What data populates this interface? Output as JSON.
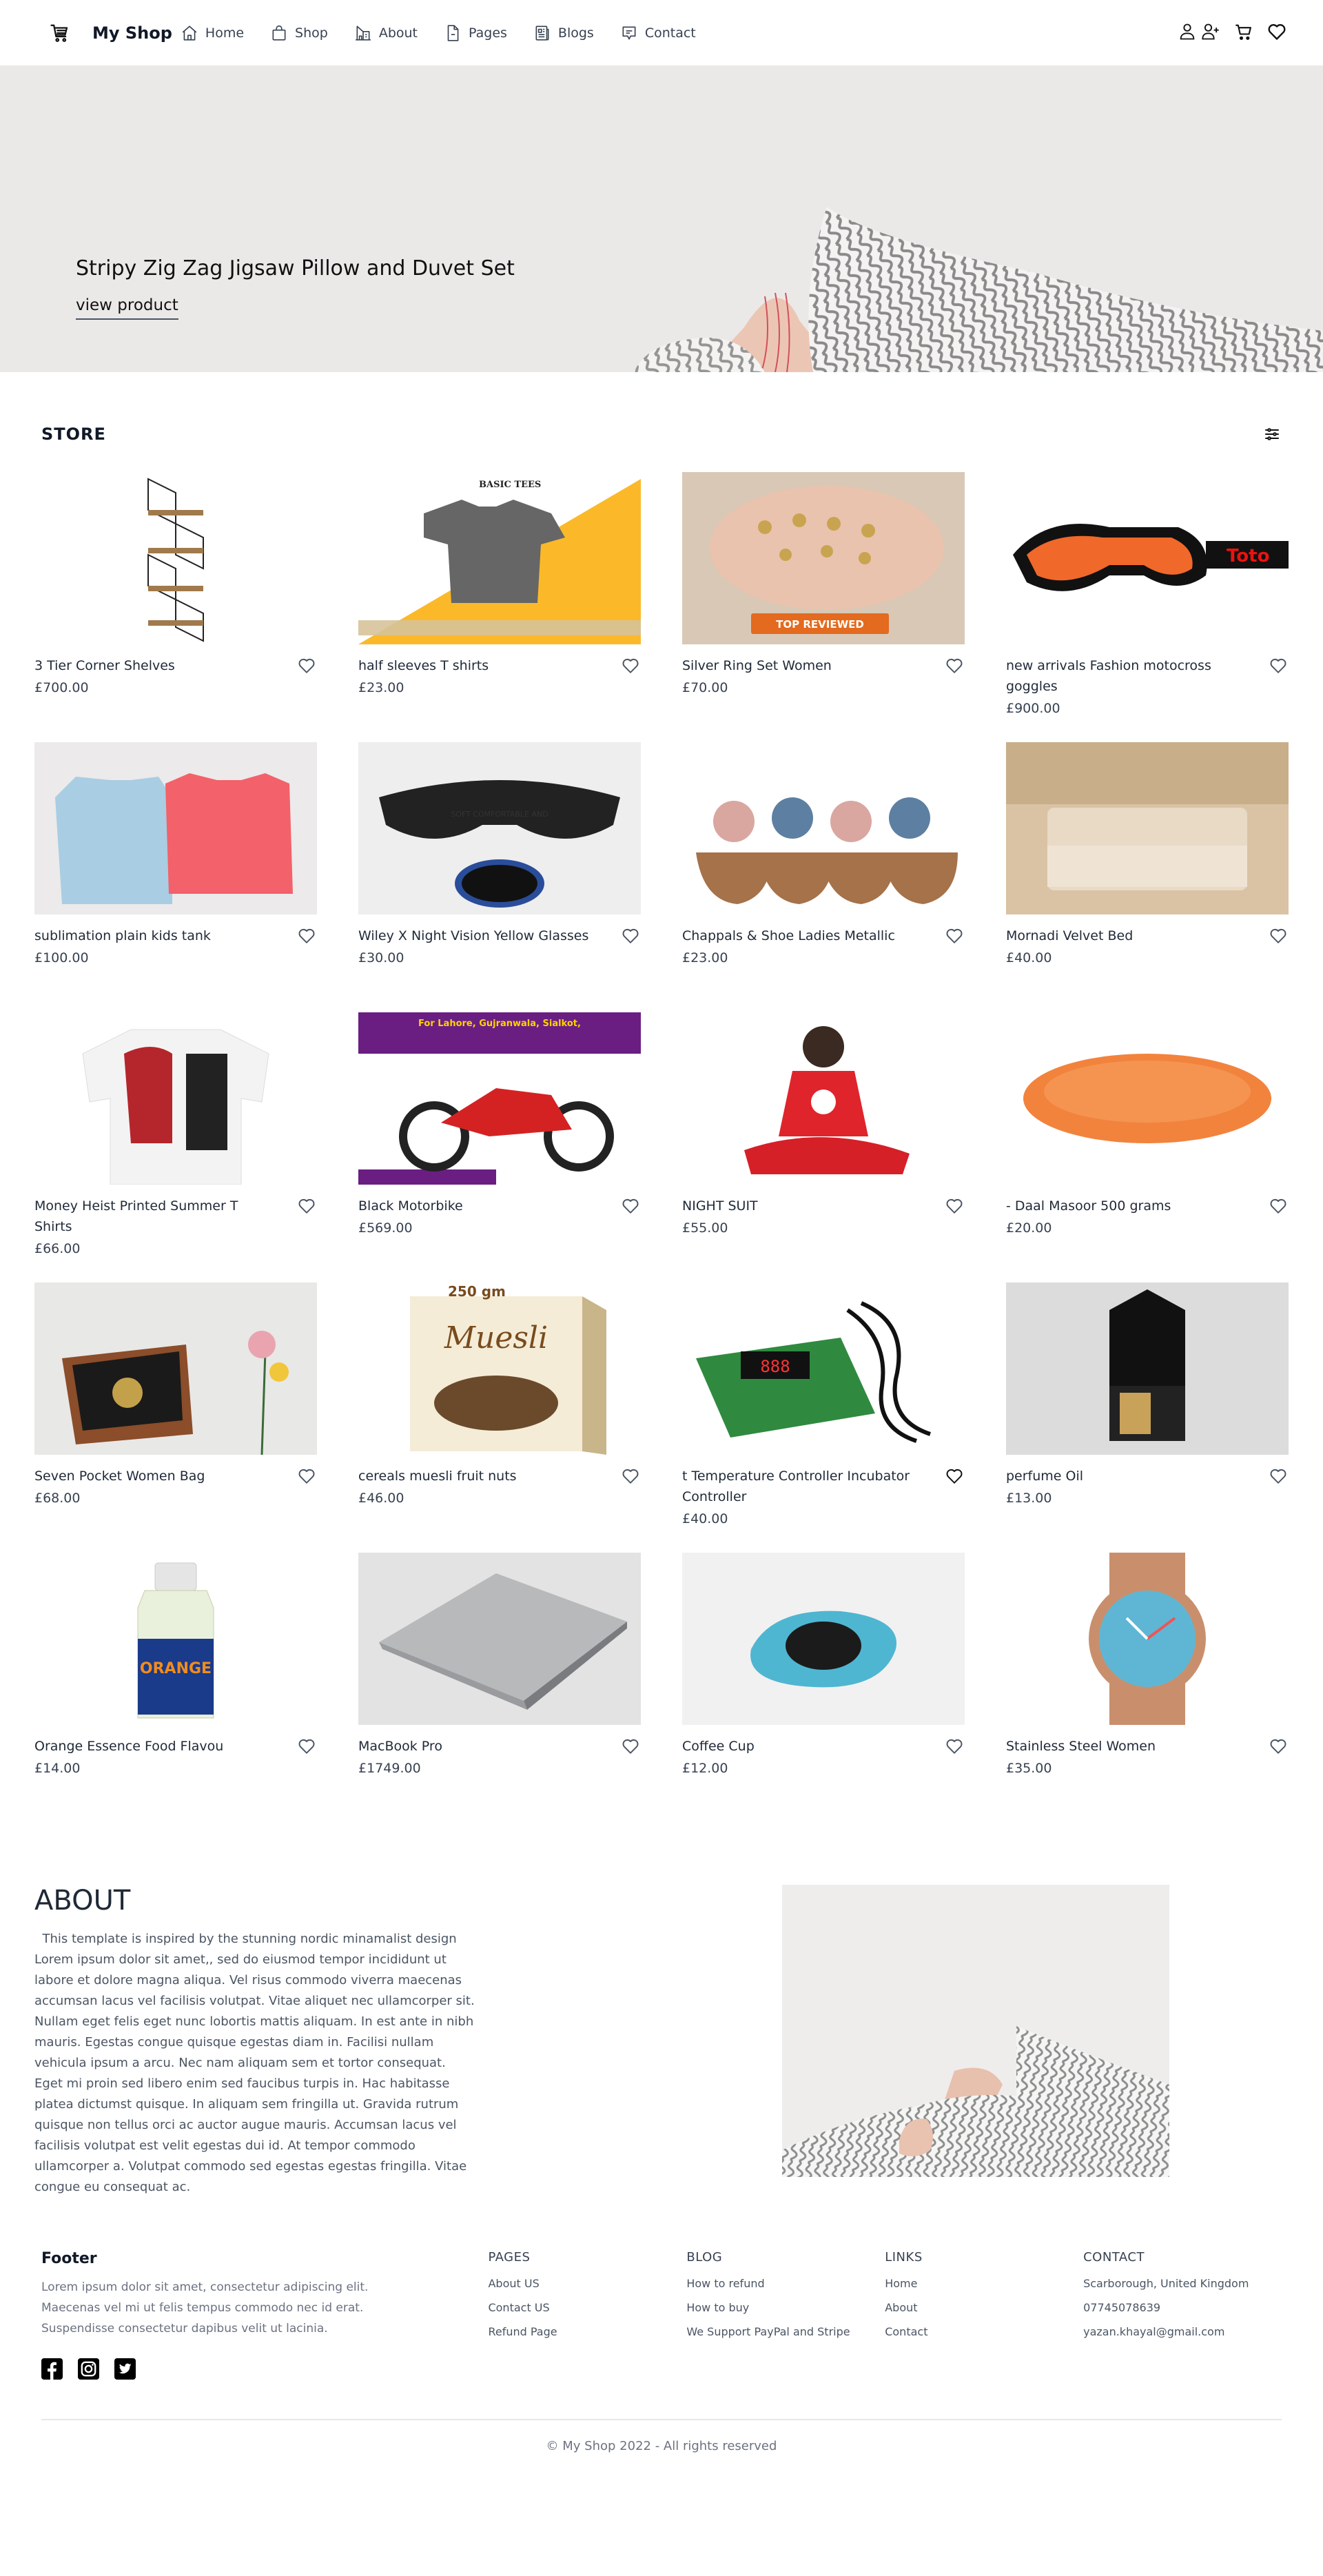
{
  "nav": {
    "brand": "My Shop",
    "links": [
      {
        "label": "Home",
        "icon": "home-icon"
      },
      {
        "label": "Shop",
        "icon": "shopping-bag-icon"
      },
      {
        "label": "About",
        "icon": "building-icon"
      },
      {
        "label": "Pages",
        "icon": "file-icon"
      },
      {
        "label": "Blogs",
        "icon": "newspaper-icon"
      },
      {
        "label": "Contact",
        "icon": "message-icon"
      }
    ],
    "right_icons": [
      "user-icon",
      "user-add-icon",
      "cart-icon",
      "heart-icon"
    ]
  },
  "hero": {
    "title": "Stripy Zig Zag Jigsaw Pillow and Duvet Set",
    "link_label": "view product"
  },
  "store": {
    "title": "STORE",
    "filter_icon": "sliders-icon",
    "products": [
      {
        "name": "3 Tier Corner Shelves",
        "price": "£700.00"
      },
      {
        "name": "half sleeves T shirts",
        "price": "£23.00"
      },
      {
        "name": "Silver Ring Set Women",
        "price": "£70.00"
      },
      {
        "name": "new arrivals Fashion motocross goggles",
        "price": "£900.00"
      },
      {
        "name": "sublimation plain kids tank",
        "price": "£100.00"
      },
      {
        "name": "Wiley X Night Vision Yellow Glasses",
        "price": "£30.00"
      },
      {
        "name": "Chappals & Shoe Ladies Metallic",
        "price": "£23.00"
      },
      {
        "name": "Mornadi Velvet Bed",
        "price": "£40.00"
      },
      {
        "name": "Money Heist Printed Summer T Shirts",
        "price": "£66.00"
      },
      {
        "name": "Black Motorbike",
        "price": "£569.00"
      },
      {
        "name": "NIGHT SUIT",
        "price": "£55.00"
      },
      {
        "name": "- Daal Masoor 500 grams",
        "price": "£20.00"
      },
      {
        "name": "Seven Pocket Women Bag",
        "price": "£68.00"
      },
      {
        "name": "cereals muesli fruit nuts",
        "price": "£46.00"
      },
      {
        "name": "t Temperature Controller Incubator Controller",
        "price": "£40.00"
      },
      {
        "name": "perfume Oil",
        "price": "£13.00"
      },
      {
        "name": "Orange Essence Food Flavou",
        "price": "£14.00"
      },
      {
        "name": "MacBook Pro",
        "price": "£1749.00"
      },
      {
        "name": "Coffee Cup",
        "price": "£12.00"
      },
      {
        "name": "Stainless Steel Women",
        "price": "£35.00"
      }
    ]
  },
  "about": {
    "title": "ABOUT",
    "body": "  This template is inspired by the stunning nordic minamalist design Lorem ipsum dolor sit amet,, sed do eiusmod tempor incididunt ut labore et dolore magna aliqua. Vel risus commodo viverra maecenas accumsan lacus vel facilisis volutpat. Vitae aliquet nec ullamcorper sit. Nullam eget felis eget nunc lobortis mattis aliquam. In est ante in nibh mauris. Egestas congue quisque egestas diam in. Facilisi nullam vehicula ipsum a arcu. Nec nam aliquam sem et tortor consequat. Eget mi proin sed libero enim sed faucibus turpis in. Hac habitasse platea dictumst quisque. In aliquam sem fringilla ut. Gravida rutrum quisque non tellus orci ac auctor augue mauris. Accumsan lacus vel facilisis volutpat est velit egestas dui id. At tempor commodo ullamcorper a. Volutpat commodo sed egestas egestas fringilla. Vitae congue eu consequat ac."
  },
  "footer": {
    "heading": "Footer",
    "description": "Lorem ipsum dolor sit amet, consectetur adipiscing elit. Maecenas vel mi ut felis tempus commodo nec id erat. Suspendisse consectetur dapibus velit ut lacinia.",
    "social": [
      "facebook-icon",
      "instagram-icon",
      "twitter-icon"
    ],
    "columns": {
      "pages": {
        "title": "PAGES",
        "items": [
          "About US",
          "Contact US",
          "Refund Page"
        ]
      },
      "blog": {
        "title": "BLOG",
        "items": [
          "How to refund",
          "How to buy",
          "We Support PayPal and Stripe"
        ]
      },
      "links": {
        "title": "LINKS",
        "items": [
          "Home",
          "About",
          "Contact"
        ]
      },
      "contact": {
        "title": "CONTACT",
        "items": [
          "Scarborough, United Kingdom",
          "07745078639",
          "yazan.khayal@gmail.com"
        ]
      }
    },
    "copyright": "© My Shop 2022 - All rights reserved"
  }
}
